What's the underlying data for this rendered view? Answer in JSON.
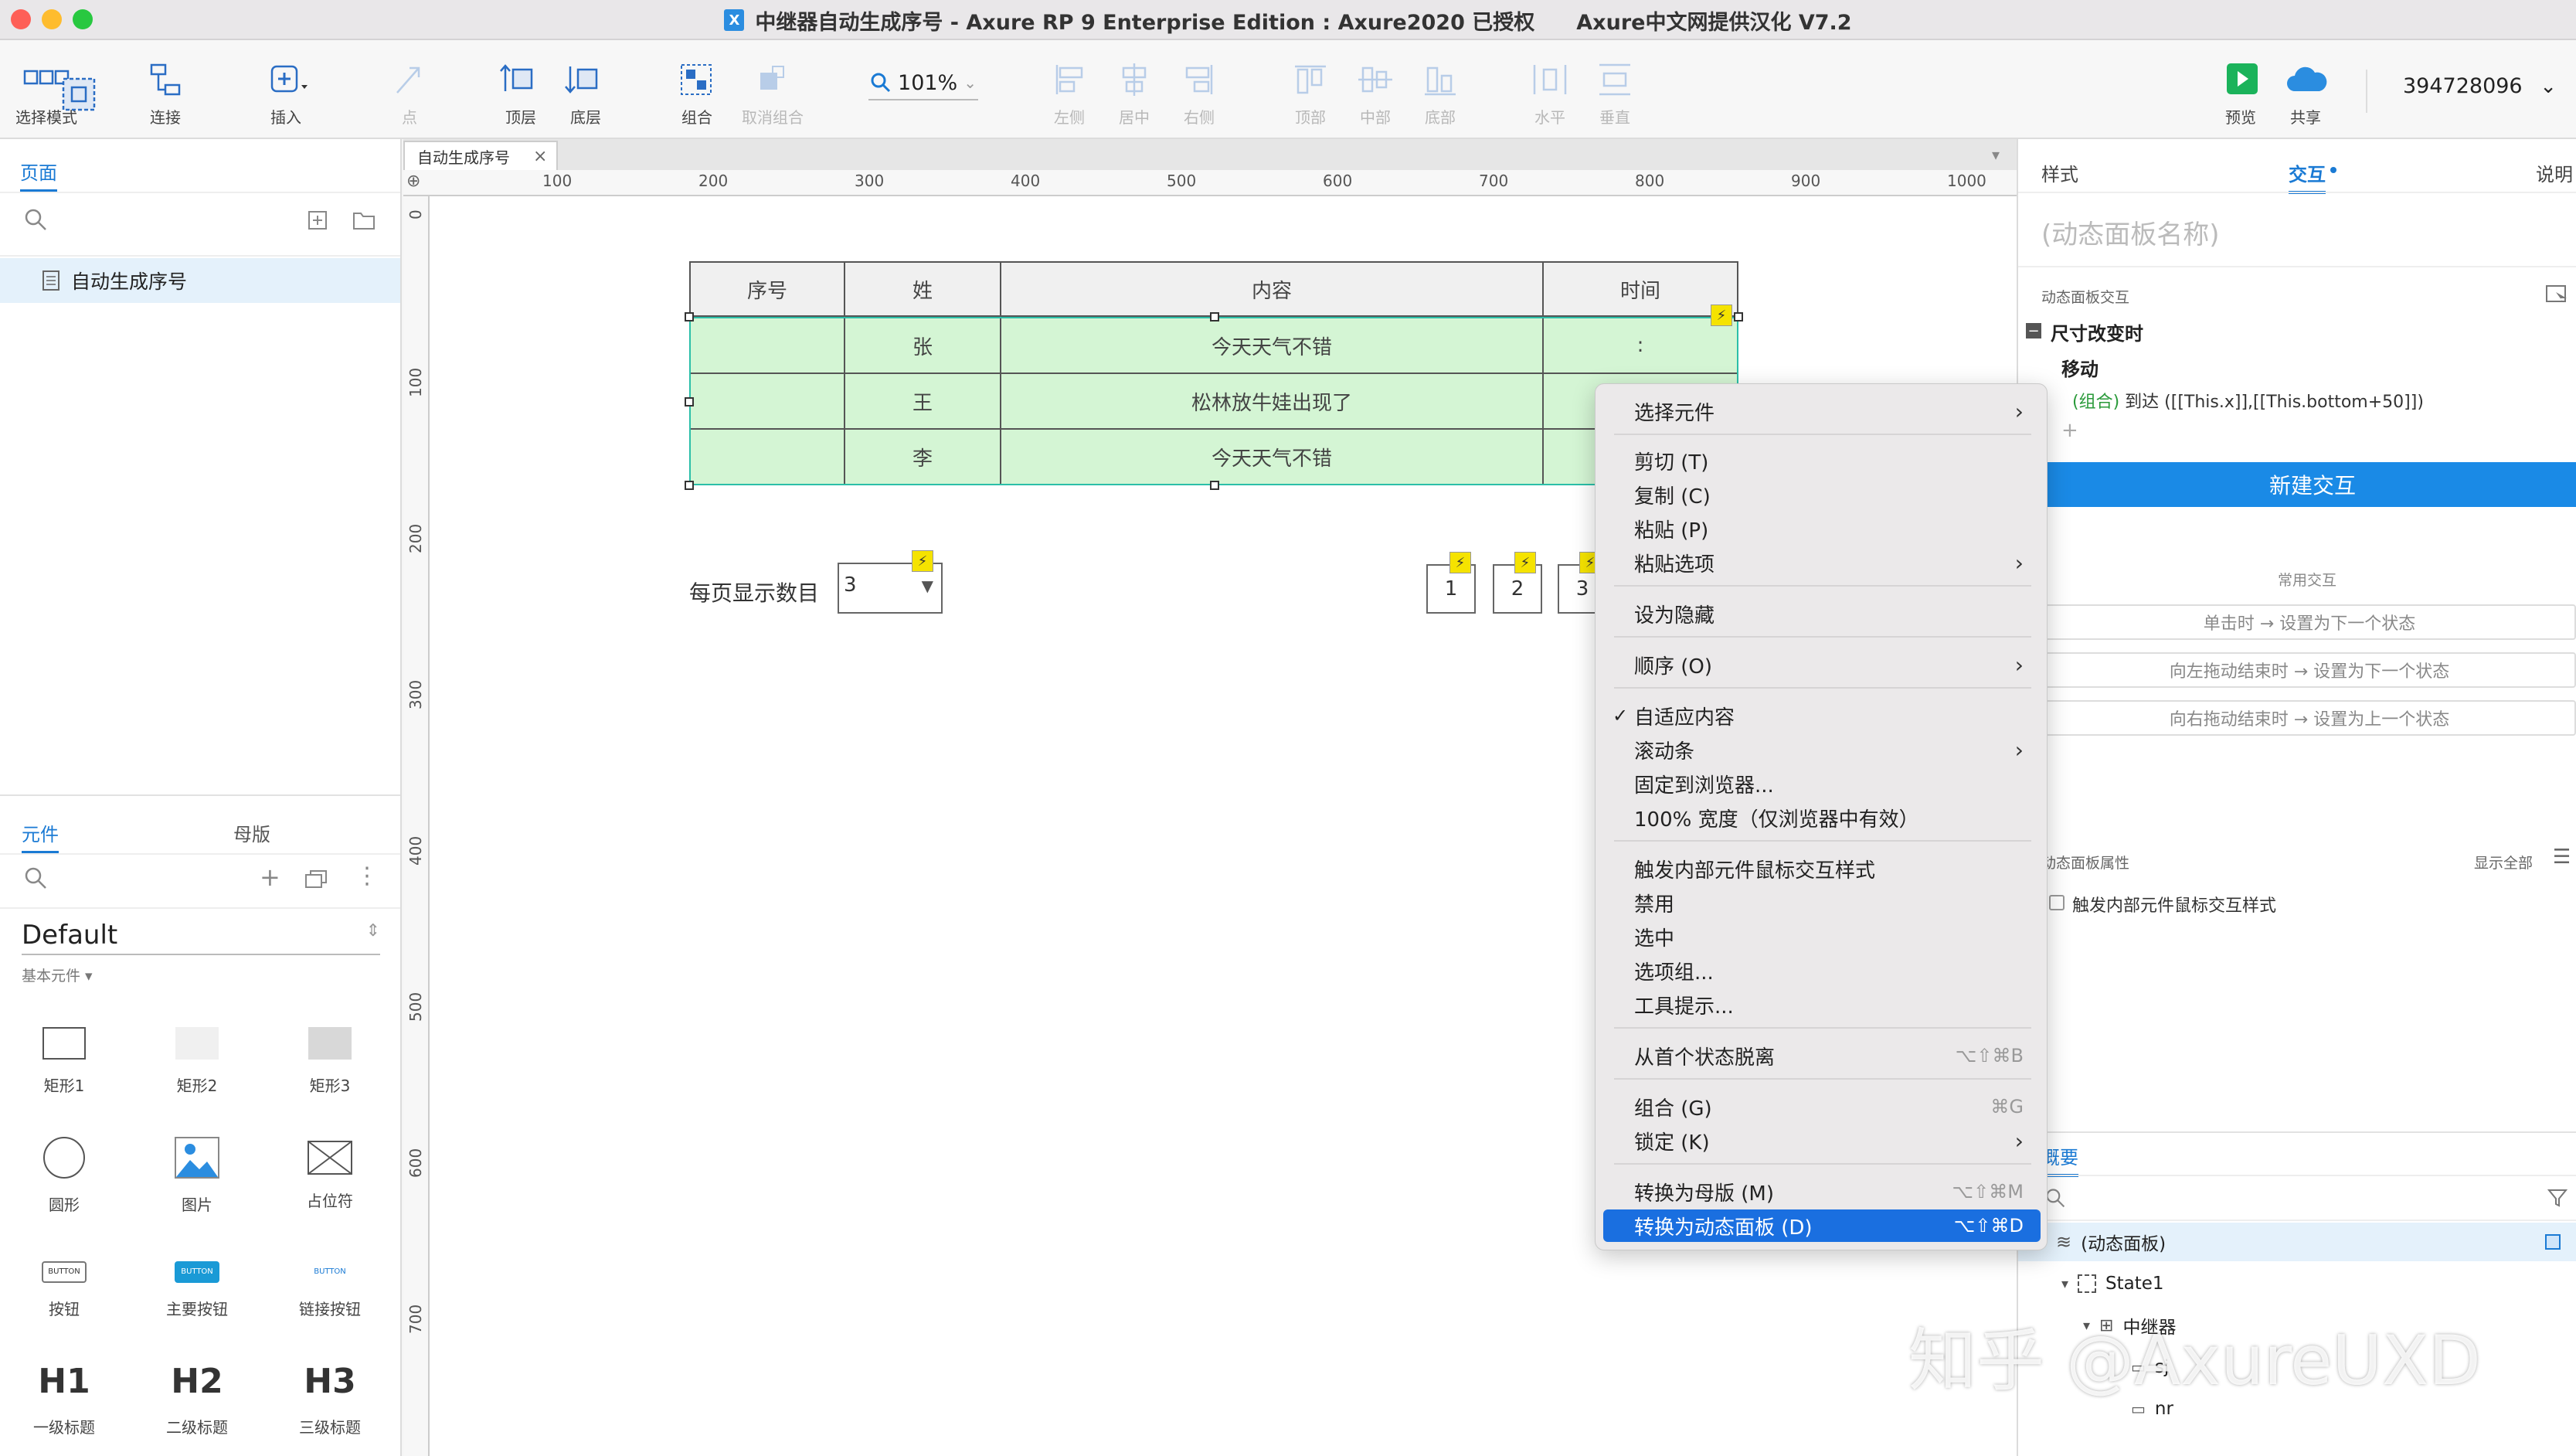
{
  "window": {
    "title": "中继器自动生成序号 - Axure RP 9 Enterprise Edition : Axure2020 已授权",
    "subtitle": "Axure中文网提供汉化 V7.2",
    "app_icon": "X"
  },
  "toolbar": {
    "select_mode": "选择模式",
    "connect": "连接",
    "insert": "插入",
    "point": "点",
    "top": "顶层",
    "bottom": "底层",
    "group": "组合",
    "ungroup": "取消组合",
    "zoom": "101%",
    "align_left": "左侧",
    "align_center": "居中",
    "align_right": "右侧",
    "align_top": "顶部",
    "align_middle": "中部",
    "align_bottom": "底部",
    "dist_h": "水平",
    "dist_v": "垂直",
    "preview": "预览",
    "share": "共享",
    "user": "394728096"
  },
  "left_panel": {
    "pages_tab": "页面",
    "page_item": "自动生成序号",
    "widgets_tab": "元件",
    "masters_tab": "母版",
    "library": "Default",
    "category": "基本元件",
    "widgets": [
      "矩形1",
      "矩形2",
      "矩形3",
      "圆形",
      "图片",
      "占位符",
      "按钮",
      "主要按钮",
      "链接按钮",
      "一级标题",
      "二级标题",
      "三级标题"
    ],
    "button_text": "BUTTON",
    "h1": "H1",
    "h2": "H2",
    "h3": "H3"
  },
  "canvas": {
    "doc_tab": "自动生成序号",
    "ruler_top": [
      "100",
      "200",
      "300",
      "400",
      "500",
      "600",
      "700",
      "800",
      "900",
      "1000"
    ],
    "ruler_left": [
      "0",
      "100",
      "200",
      "300",
      "400",
      "500",
      "600",
      "700"
    ],
    "table_headers": [
      "序号",
      "姓",
      "内容",
      "时间"
    ],
    "rows": [
      {
        "surname": "张",
        "content": "今天天气不错",
        "time": ":"
      },
      {
        "surname": "王",
        "content": "松林放牛娃出现了",
        "time": ""
      },
      {
        "surname": "李",
        "content": "今天天气不错",
        "time": ""
      }
    ],
    "per_page_label": "每页显示数目",
    "per_page_value": "3",
    "pages": [
      "1",
      "2",
      "3"
    ]
  },
  "right_panel": {
    "style_tab": "样式",
    "interaction_tab": "交互",
    "notes_tab": "说明",
    "panel_name_placeholder": "(动态面板名称)",
    "section_interaction": "动态面板交互",
    "event": "尺寸改变时",
    "action": "移动",
    "action_target": "(组合)",
    "action_detail": "到达 ([[This.x]],[[This.bottom+50]])",
    "new_interaction": "新建交互",
    "common_title": "常用交互",
    "common": [
      "单击时 → 设置为下一个状态",
      "向左拖动结束时 → 设置为下一个状态",
      "向右拖动结束时 → 设置为上一个状态"
    ],
    "props_title": "动态面板属性",
    "show_all": "显示全部",
    "prop_trigger": "触发内部元件鼠标交互样式",
    "outline_tab": "概要",
    "outline": [
      "(动态面板)",
      "State1",
      "中继器",
      "sj",
      "nr"
    ]
  },
  "context_menu": {
    "items": [
      {
        "label": "选择元件",
        "arrow": true
      },
      {
        "label": "剪切 (T)"
      },
      {
        "label": "复制 (C)"
      },
      {
        "label": "粘贴 (P)"
      },
      {
        "label": "粘贴选项",
        "arrow": true
      },
      {
        "label": "设为隐藏"
      },
      {
        "label": "顺序 (O)",
        "arrow": true
      },
      {
        "label": "自适应内容",
        "checked": true
      },
      {
        "label": "滚动条",
        "arrow": true
      },
      {
        "label": "固定到浏览器..."
      },
      {
        "label": "100% 宽度（仅浏览器中有效）"
      },
      {
        "label": "触发内部元件鼠标交互样式"
      },
      {
        "label": "禁用"
      },
      {
        "label": "选中"
      },
      {
        "label": "选项组..."
      },
      {
        "label": "工具提示..."
      },
      {
        "label": "从首个状态脱离",
        "shortcut": "⌥⇧⌘B"
      },
      {
        "label": "组合 (G)",
        "shortcut": "⌘G"
      },
      {
        "label": "锁定 (K)",
        "arrow": true
      },
      {
        "label": "转换为母版 (M)",
        "shortcut": "⌥⇧⌘M"
      },
      {
        "label": "转换为动态面板 (D)",
        "shortcut": "⌥⇧⌘D",
        "highlight": true
      }
    ],
    "check_mark": "✓",
    "arrow_glyph": "›"
  },
  "watermark": "知乎 @AxureUXD",
  "colors": {
    "accent": "#1a7ad4",
    "row_bg": "#d4f5d4",
    "highlight": "#1a6fe0",
    "bolt": "#f5e300"
  }
}
